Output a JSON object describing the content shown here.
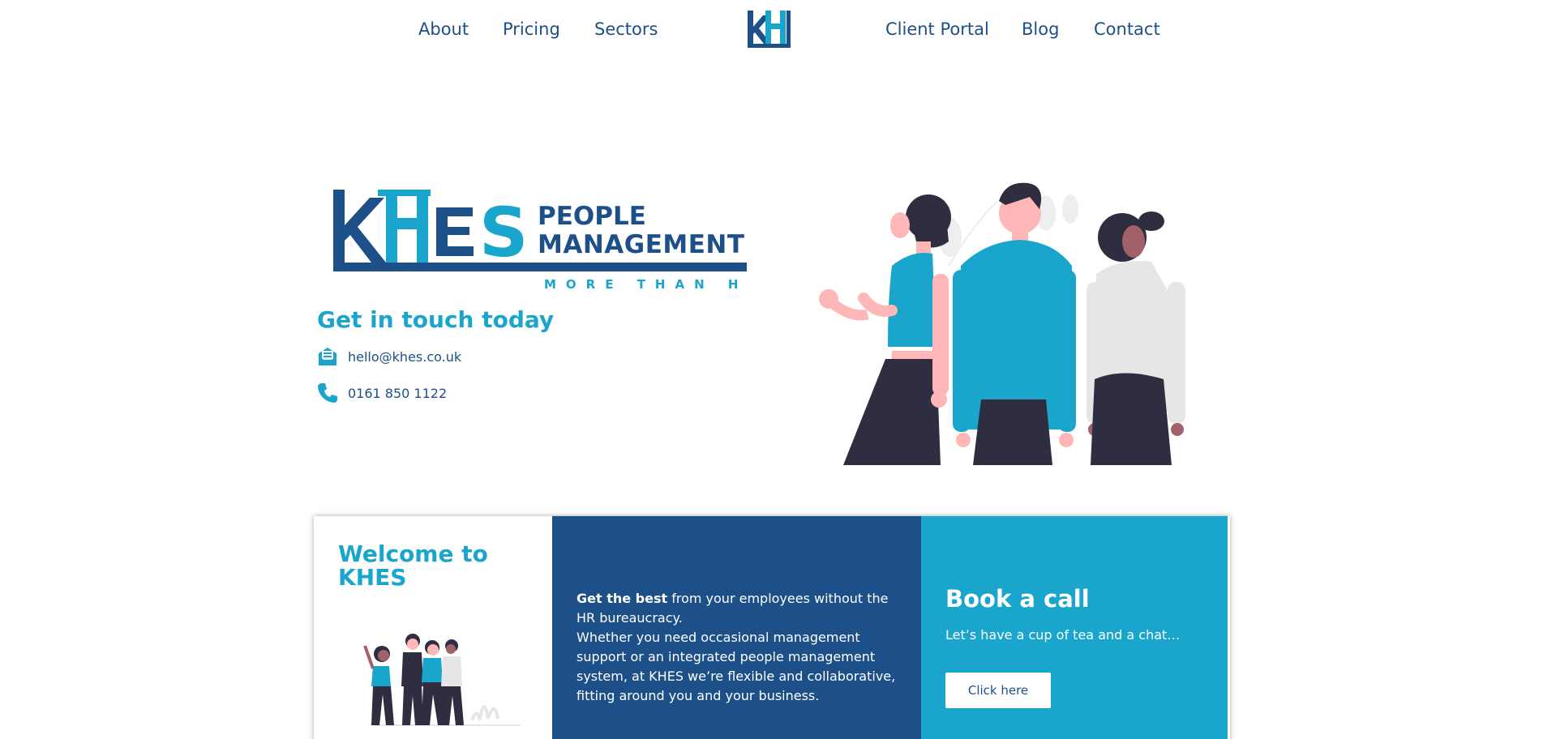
{
  "nav": {
    "left": [
      "About",
      "Pricing",
      "Sectors"
    ],
    "right": [
      "Client Portal",
      "Blog",
      "Contact"
    ],
    "logo_text": "KH"
  },
  "hero": {
    "logo": {
      "mark": "KHES",
      "line1": "PEOPLE",
      "line2": "MANAGEMENT",
      "tagline": "MORE THAN HR"
    },
    "title": "Get in touch today",
    "email": "hello@khes.co.uk",
    "phone": "0161 850 1122",
    "email_icon": "envelope-icon",
    "phone_icon": "phone-icon"
  },
  "cards": {
    "welcome": {
      "title": "Welcome to KHES"
    },
    "intro": {
      "bold": "Get the best",
      "text1": " from your employees without the HR bureaucracy.",
      "text2": "Whether you need occasional management support or an integrated people management system, at KHES we’re flexible and collaborative, fitting around you and your business."
    },
    "book": {
      "title": "Book a call",
      "subtitle": "Let’s have a cup of tea and a chat…",
      "button": "Click here"
    }
  },
  "colors": {
    "navy": "#1d5088",
    "teal": "#1aa6cc",
    "dark": "#2f2e41",
    "skin": "#ffb6b6",
    "grey": "#e6e6e6"
  }
}
